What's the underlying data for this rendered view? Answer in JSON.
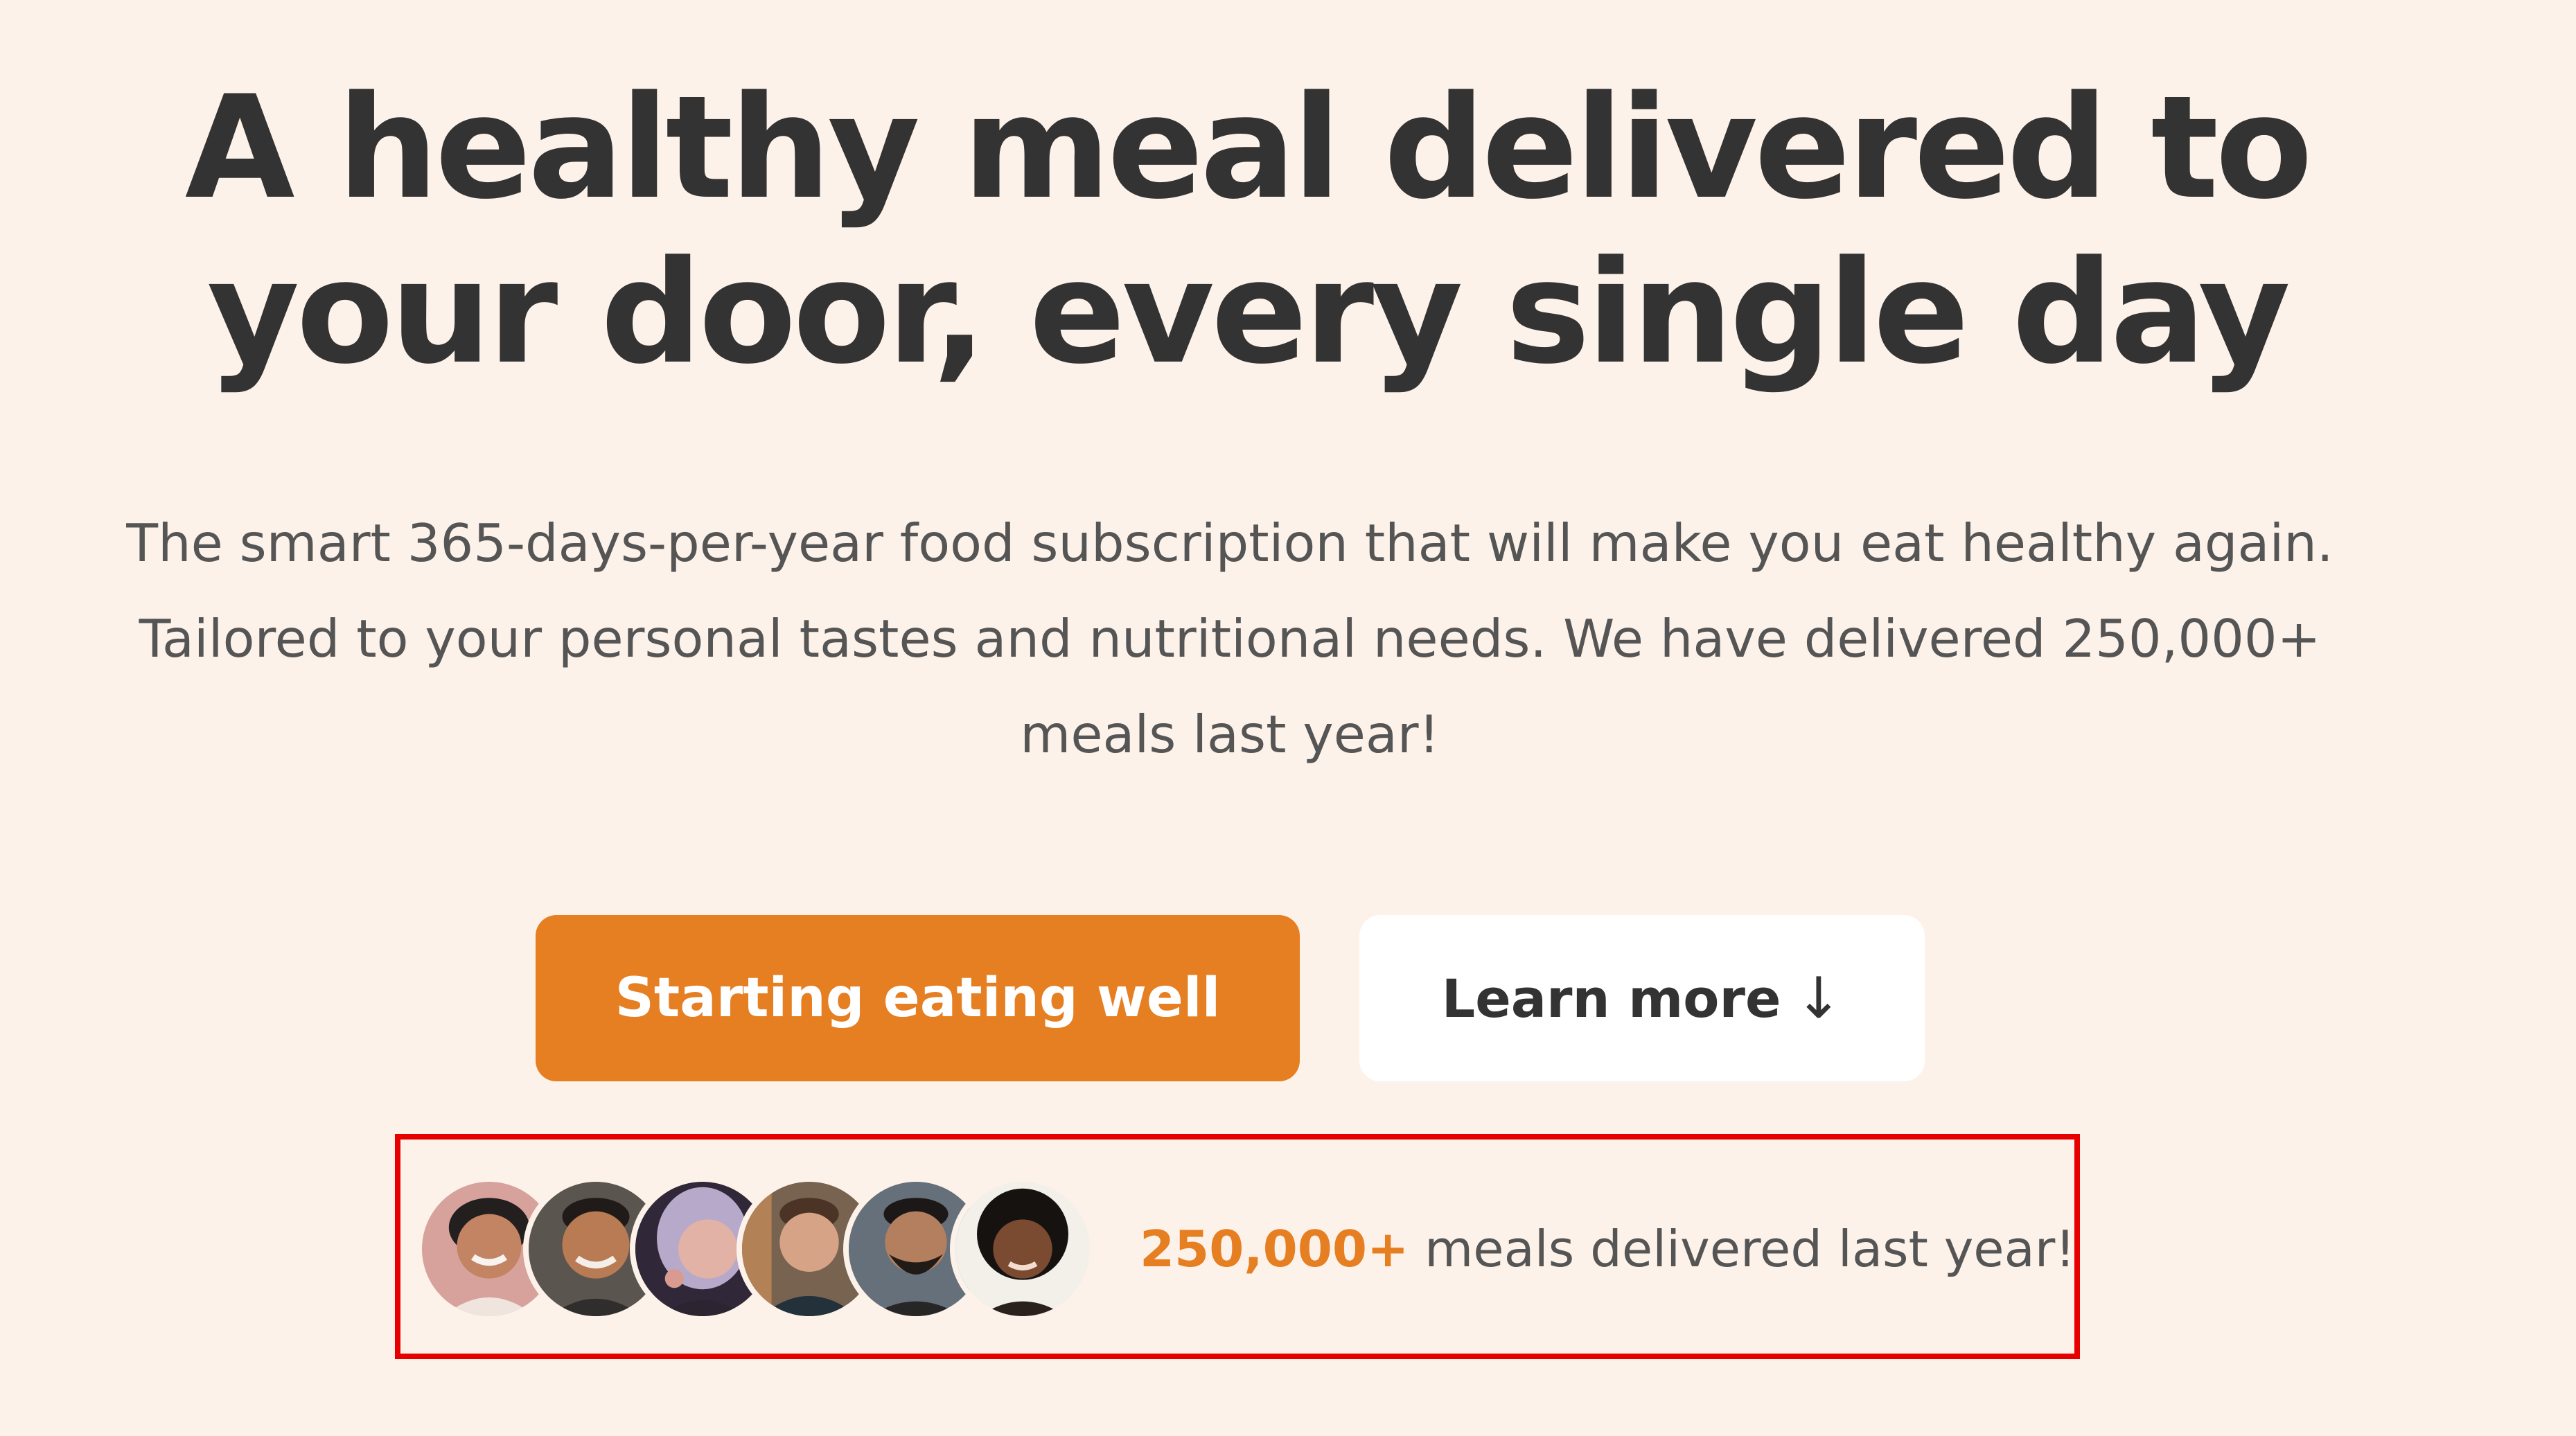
{
  "hero": {
    "title_line1": "A healthy meal delivered to",
    "title_line2": "your door, every single day",
    "description": "The smart 365-days-per-year food subscription that will make you eat healthy again. Tailored to your personal tastes and nutritional needs. We have delivered 250,000+ meals last year!"
  },
  "buttons": {
    "primary_label": "Starting eating well",
    "secondary_label": "Learn more",
    "secondary_icon": "↓"
  },
  "delivered": {
    "count": "250,000+",
    "text": "meals delivered last year!"
  },
  "customers": [
    {
      "name": "customer-1"
    },
    {
      "name": "customer-2"
    },
    {
      "name": "customer-3"
    },
    {
      "name": "customer-4"
    },
    {
      "name": "customer-5"
    },
    {
      "name": "customer-6"
    }
  ],
  "colors": {
    "background": "#fdf2e9",
    "accent": "#e67e22",
    "heading": "#333333",
    "text": "#555555",
    "highlight_border": "#e60000"
  }
}
